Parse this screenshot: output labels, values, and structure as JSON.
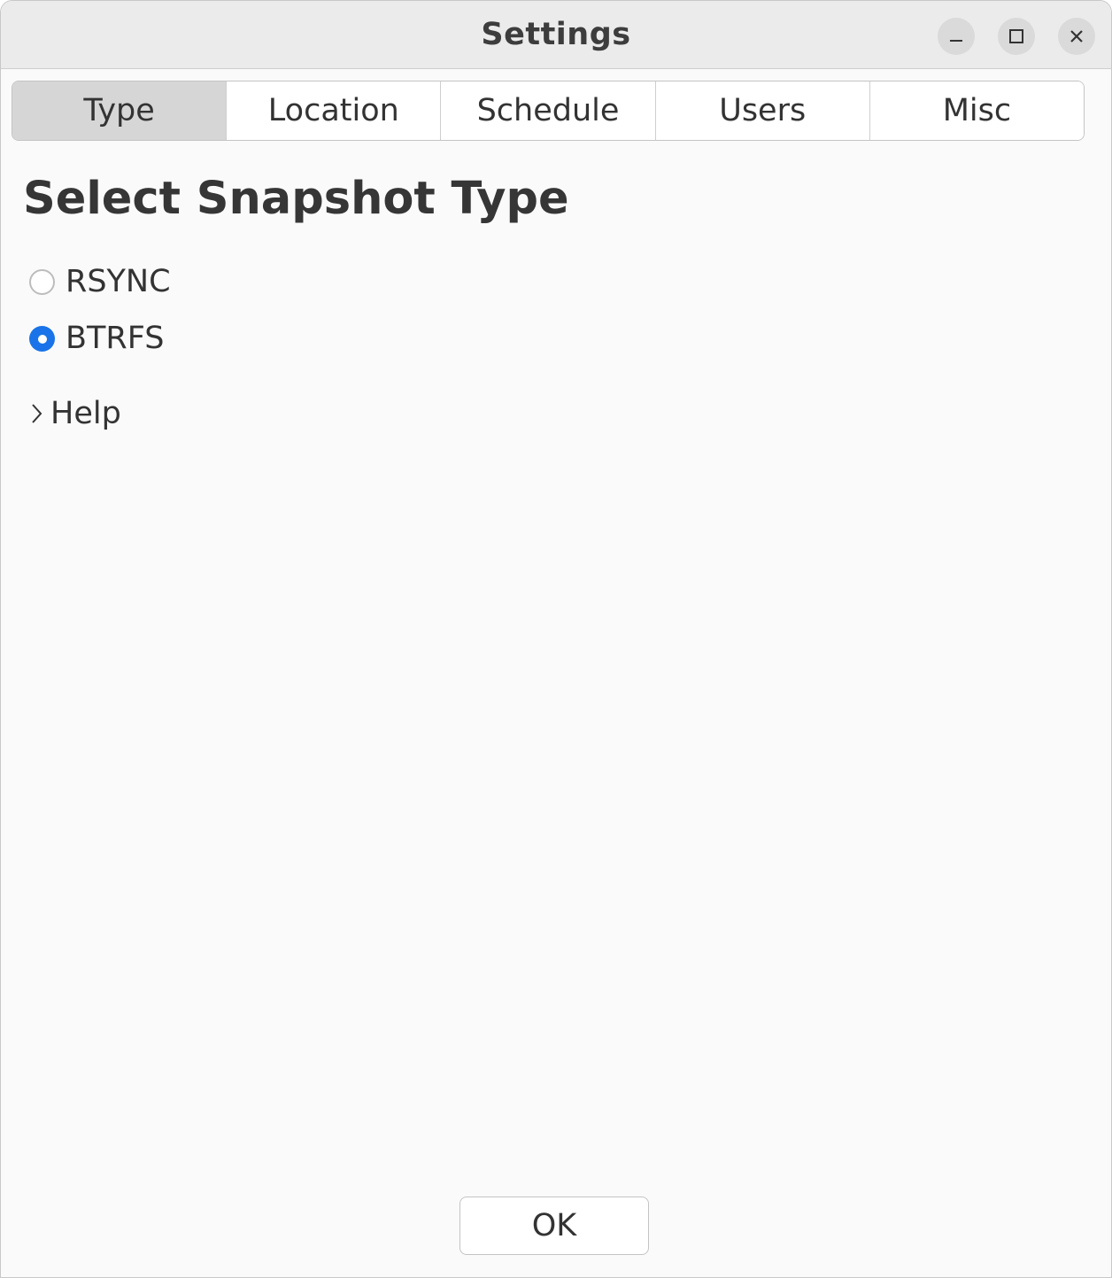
{
  "window": {
    "title": "Settings",
    "controls": [
      "minimize-icon",
      "maximize-icon",
      "close-icon"
    ]
  },
  "tabs": [
    {
      "label": "Type",
      "active": true
    },
    {
      "label": "Location",
      "active": false
    },
    {
      "label": "Schedule",
      "active": false
    },
    {
      "label": "Users",
      "active": false
    },
    {
      "label": "Misc",
      "active": false
    }
  ],
  "main": {
    "heading": "Select Snapshot Type",
    "options": [
      {
        "label": "RSYNC",
        "selected": false
      },
      {
        "label": "BTRFS",
        "selected": true
      }
    ],
    "help_label": "Help"
  },
  "footer": {
    "ok_label": "OK"
  },
  "colors": {
    "accent": "#1a73e8",
    "active_tab": "#d6d6d6",
    "titlebar": "#ebebeb",
    "background": "#fafafa"
  }
}
